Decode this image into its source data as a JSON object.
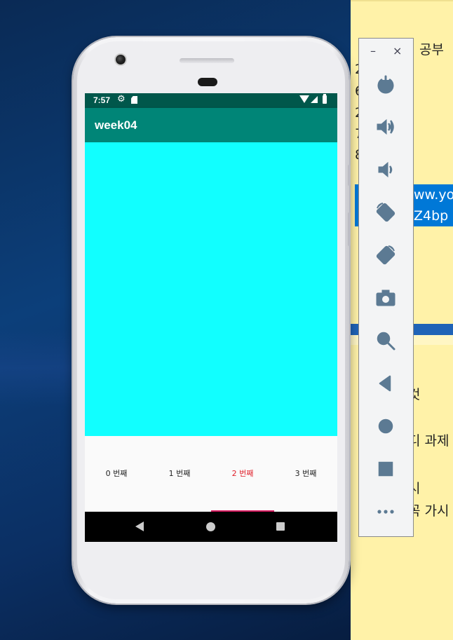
{
  "note": {
    "lines": [
      {
        "text": "공부"
      },
      {
        "text": "2"
      },
      {
        "text": "6"
      },
      {
        "text": "2"
      },
      {
        "text": "7"
      },
      {
        "text": "8"
      },
      {
        "text": "것"
      },
      {
        "text": "디 과제"
      },
      {
        "text": "시"
      },
      {
        "text": "꼭 가시"
      }
    ],
    "highlight": [
      "ww.yo",
      "Z4bp"
    ]
  },
  "phone": {
    "status_bar": {
      "time": "7:57"
    },
    "app_bar": {
      "title": "week04"
    },
    "content_color": "#11ffff",
    "tabs": [
      {
        "label": "0 번째"
      },
      {
        "label": "1 번째"
      },
      {
        "label": "2 번째",
        "selected": true
      },
      {
        "label": "3 번째"
      }
    ],
    "accent_color": "#d81b60",
    "app_bar_color": "#008577"
  },
  "emulator_toolbar": {
    "window_controls": {
      "minimize": "–",
      "close": "×"
    },
    "buttons": [
      {
        "icon": "power-icon"
      },
      {
        "icon": "volume-up-icon"
      },
      {
        "icon": "volume-down-icon"
      },
      {
        "icon": "rotate-left-icon"
      },
      {
        "icon": "rotate-right-icon"
      },
      {
        "icon": "camera-icon"
      },
      {
        "icon": "zoom-icon"
      },
      {
        "icon": "back-icon"
      },
      {
        "icon": "home-icon"
      },
      {
        "icon": "overview-icon"
      },
      {
        "icon": "more-icon"
      }
    ]
  }
}
